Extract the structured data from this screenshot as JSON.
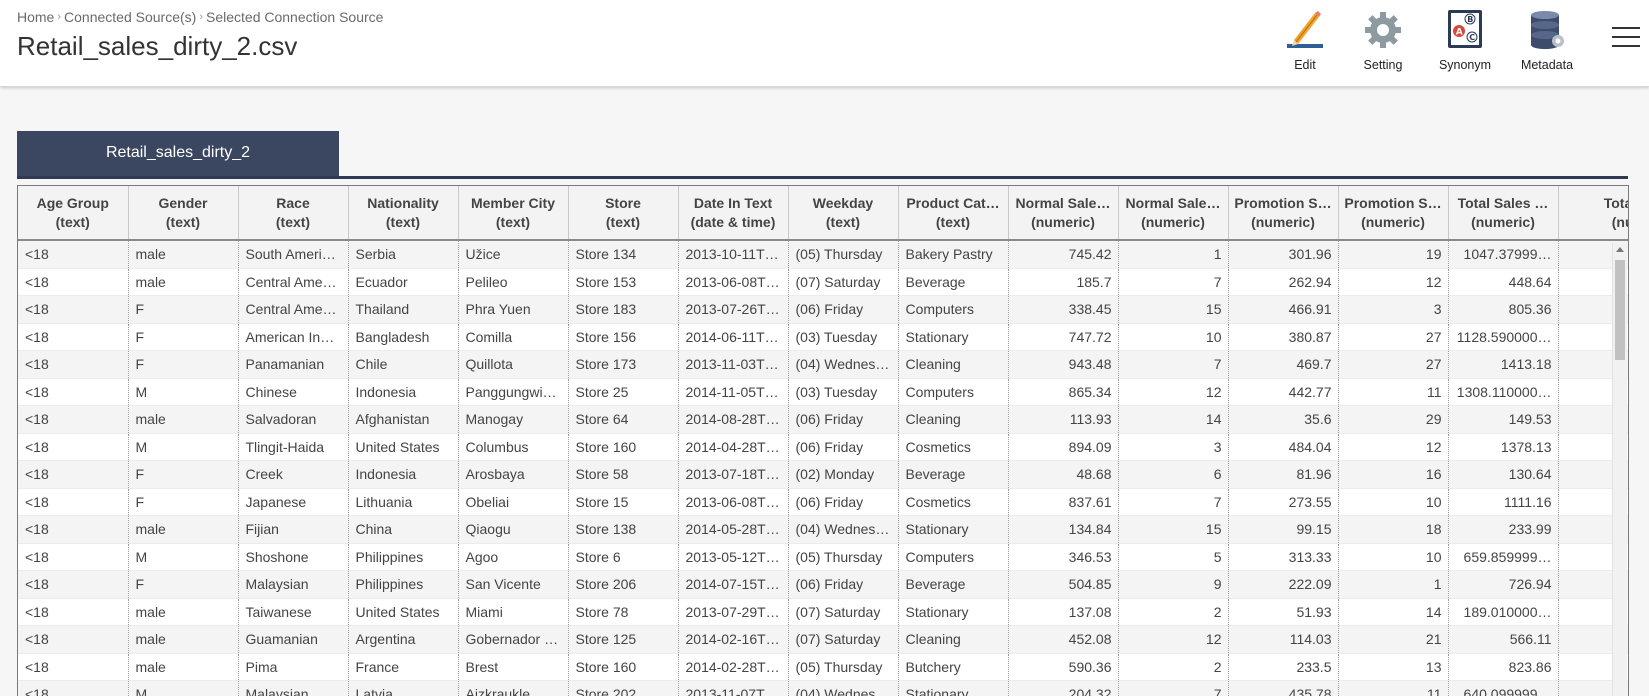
{
  "breadcrumb": [
    "Home",
    "Connected Source(s)",
    "Selected Connection Source"
  ],
  "title": "Retail_sales_dirty_2.csv",
  "toolbar": {
    "edit": "Edit",
    "setting": "Setting",
    "synonym": "Synonym",
    "metadata": "Metadata"
  },
  "icons": {
    "edit": "pencil-icon",
    "setting": "gear-icon",
    "synonym": "abc-book-icon",
    "metadata": "database-icon",
    "menu": "hamburger-menu-icon"
  },
  "tab": {
    "label": "Retail_sales_dirty_2"
  },
  "columns": [
    {
      "name": "Age Group",
      "type": "(text)"
    },
    {
      "name": "Gender",
      "type": "(text)"
    },
    {
      "name": "Race",
      "type": "(text)"
    },
    {
      "name": "Nationality",
      "type": "(text)"
    },
    {
      "name": "Member City",
      "type": "(text)"
    },
    {
      "name": "Store",
      "type": "(text)"
    },
    {
      "name": "Date In Text",
      "type": "(date & time)"
    },
    {
      "name": "Weekday",
      "type": "(text)"
    },
    {
      "name": "Product Cat…",
      "type": "(text)"
    },
    {
      "name": "Normal Sale…",
      "type": "(numeric)"
    },
    {
      "name": "Normal Sale…",
      "type": "(numeric)"
    },
    {
      "name": "Promotion S…",
      "type": "(numeric)"
    },
    {
      "name": "Promotion S…",
      "type": "(numeric)"
    },
    {
      "name": "Total Sales …",
      "type": "(numeric)"
    },
    {
      "name": "Total sale",
      "type": "(numer"
    }
  ],
  "rows": [
    [
      "<18",
      "male",
      "South Ameri…",
      "Serbia",
      "Užice",
      "Store 134",
      "2013-10-11T…",
      "(05) Thursday",
      "Bakery Pastry",
      "745.42",
      "1",
      "301.96",
      "19",
      "1047.37999…",
      ""
    ],
    [
      "<18",
      "male",
      "Central Ame…",
      "Ecuador",
      "Pelileo",
      "Store 153",
      "2013-06-08T…",
      "(07) Saturday",
      "Beverage",
      "185.7",
      "7",
      "262.94",
      "12",
      "448.64",
      ""
    ],
    [
      "<18",
      "F",
      "Central Ame…",
      "Thailand",
      "Phra Yuen",
      "Store 183",
      "2013-07-26T…",
      "(06) Friday",
      "Computers",
      "338.45",
      "15",
      "466.91",
      "3",
      "805.36",
      ""
    ],
    [
      "<18",
      "F",
      "American In…",
      "Bangladesh",
      "Comilla",
      "Store 156",
      "2014-06-11T…",
      "(03) Tuesday",
      "Stationary",
      "747.72",
      "10",
      "380.87",
      "27",
      "1128.590000…",
      ""
    ],
    [
      "<18",
      "F",
      "Panamanian",
      "Chile",
      "Quillota",
      "Store 173",
      "2013-11-03T…",
      "(04) Wednes…",
      "Cleaning",
      "943.48",
      "7",
      "469.7",
      "27",
      "1413.18",
      ""
    ],
    [
      "<18",
      "M",
      "Chinese",
      "Indonesia",
      "Panggungwi…",
      "Store 25",
      "2014-11-05T…",
      "(03) Tuesday",
      "Computers",
      "865.34",
      "12",
      "442.77",
      "11",
      "1308.110000…",
      ""
    ],
    [
      "<18",
      "male",
      "Salvadoran",
      "Afghanistan",
      "Manogay",
      "Store 64",
      "2014-08-28T…",
      "(06) Friday",
      "Cleaning",
      "113.93",
      "14",
      "35.6",
      "29",
      "149.53",
      ""
    ],
    [
      "<18",
      "M",
      "Tlingit-Haida",
      "United States",
      "Columbus",
      "Store 160",
      "2014-04-28T…",
      "(06) Friday",
      "Cosmetics",
      "894.09",
      "3",
      "484.04",
      "12",
      "1378.13",
      ""
    ],
    [
      "<18",
      "F",
      "Creek",
      "Indonesia",
      "Arosbaya",
      "Store 58",
      "2013-07-18T…",
      "(02) Monday",
      "Beverage",
      "48.68",
      "6",
      "81.96",
      "16",
      "130.64",
      ""
    ],
    [
      "<18",
      "F",
      "Japanese",
      "Lithuania",
      "Obeliai",
      "Store 15",
      "2013-06-08T…",
      "(06) Friday",
      "Cosmetics",
      "837.61",
      "7",
      "273.55",
      "10",
      "1111.16",
      ""
    ],
    [
      "<18",
      "male",
      "Fijian",
      "China",
      "Qiaogu",
      "Store 138",
      "2014-05-28T…",
      "(04) Wednes…",
      "Stationary",
      "134.84",
      "15",
      "99.15",
      "18",
      "233.99",
      ""
    ],
    [
      "<18",
      "M",
      "Shoshone",
      "Philippines",
      "Agoo",
      "Store 6",
      "2013-05-12T…",
      "(05) Thursday",
      "Computers",
      "346.53",
      "5",
      "313.33",
      "10",
      "659.859999…",
      ""
    ],
    [
      "<18",
      "F",
      "Malaysian",
      "Philippines",
      "San Vicente",
      "Store 206",
      "2014-07-15T…",
      "(06) Friday",
      "Beverage",
      "504.85",
      "9",
      "222.09",
      "1",
      "726.94",
      ""
    ],
    [
      "<18",
      "male",
      "Taiwanese",
      "United States",
      "Miami",
      "Store 78",
      "2013-07-29T…",
      "(07) Saturday",
      "Stationary",
      "137.08",
      "2",
      "51.93",
      "14",
      "189.010000…",
      ""
    ],
    [
      "<18",
      "male",
      "Guamanian",
      "Argentina",
      "Gobernador …",
      "Store 125",
      "2014-02-16T…",
      "(07) Saturday",
      "Cleaning",
      "452.08",
      "12",
      "114.03",
      "21",
      "566.11",
      ""
    ],
    [
      "<18",
      "male",
      "Pima",
      "France",
      "Brest",
      "Store 160",
      "2014-02-28T…",
      "(05) Thursday",
      "Butchery",
      "590.36",
      "2",
      "233.5",
      "13",
      "823.86",
      ""
    ],
    [
      "<18",
      "M",
      "Malaysian",
      "Latvia",
      "Aizkraukle",
      "Store 202",
      "2013-11-07T…",
      "(04) Wednes…",
      "Stationary",
      "204.32",
      "7",
      "435.78",
      "11",
      "640.099999…",
      ""
    ]
  ]
}
